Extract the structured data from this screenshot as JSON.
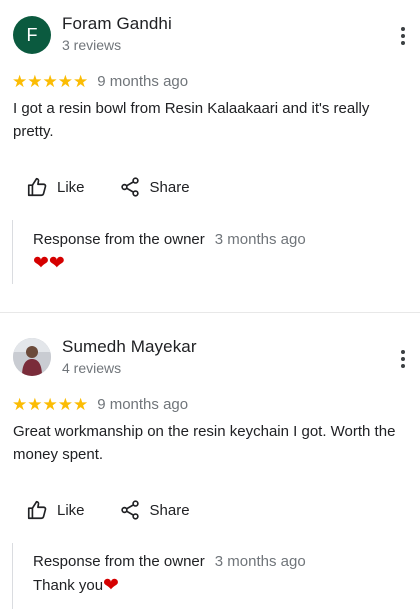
{
  "reviews": [
    {
      "author": "Foram Gandhi",
      "avatar_letter": "F",
      "meta": "3 reviews",
      "stars": "★★★★★",
      "date": "9 months ago",
      "text": "I got a resin bowl from Resin Kalaakaari and it's really pretty.",
      "like_label": "Like",
      "share_label": "Share",
      "owner_label": "Response from the owner",
      "owner_date": "3 months ago",
      "owner_text": "",
      "owner_hearts": "❤❤"
    },
    {
      "author": "Sumedh Mayekar",
      "meta": "4 reviews",
      "stars": "★★★★★",
      "date": "9 months ago",
      "text": "Great workmanship on the resin keychain I got. Worth the money spent.",
      "like_label": "Like",
      "share_label": "Share",
      "owner_label": "Response from the owner",
      "owner_date": "3 months ago",
      "owner_text": "Thank you",
      "owner_hearts": "❤"
    }
  ],
  "colors": {
    "star": "#fbbc04",
    "avatar_bg": "#0b5a3f",
    "heart": "#d50000"
  },
  "icons": [
    "thumbs-up-icon",
    "share-icon",
    "more-vert-icon",
    "star-icon",
    "heart-icon"
  ]
}
